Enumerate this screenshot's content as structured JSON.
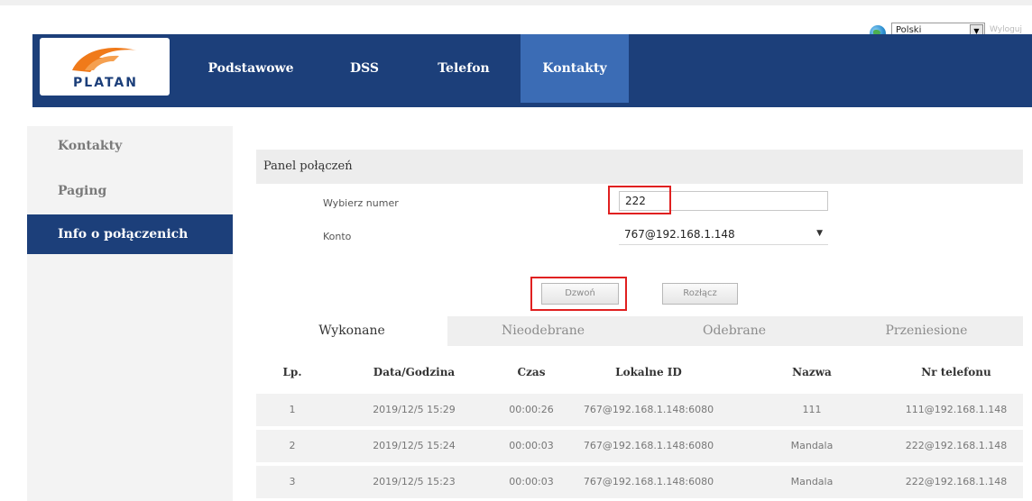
{
  "language": {
    "selected": "Polski",
    "extra": "Wyloguj"
  },
  "header": {
    "logo_text": "PLATAN",
    "nav": [
      {
        "label": "Podstawowe",
        "active": false
      },
      {
        "label": "DSS",
        "active": false
      },
      {
        "label": "Telefon",
        "active": false
      },
      {
        "label": "Kontakty",
        "active": true
      }
    ]
  },
  "sidebar": {
    "items": [
      {
        "label": "Kontakty",
        "active": false
      },
      {
        "label": "Paging",
        "active": false
      },
      {
        "label": "Info o połączenich",
        "active": true
      }
    ]
  },
  "panel": {
    "title": "Panel połączeń",
    "dial_label": "Wybierz numer",
    "dial_value": "222",
    "account_label": "Konto",
    "account_value": "767@192.168.1.148",
    "call_button": "Dzwoń",
    "hangup_button": "Rozłącz"
  },
  "tabs": [
    {
      "label": "Wykonane",
      "active": true
    },
    {
      "label": "Nieodebrane",
      "active": false
    },
    {
      "label": "Odebrane",
      "active": false
    },
    {
      "label": "Przeniesione",
      "active": false
    }
  ],
  "table": {
    "headers": [
      "Lp.",
      "Data/Godzina",
      "Czas",
      "Lokalne ID",
      "Nazwa",
      "Nr telefonu"
    ],
    "rows": [
      [
        "1",
        "2019/12/5 15:29",
        "00:00:26",
        "767@192.168.1.148:6080",
        "111",
        "111@192.168.1.148"
      ],
      [
        "2",
        "2019/12/5 15:24",
        "00:00:03",
        "767@192.168.1.148:6080",
        "Mandala",
        "222@192.168.1.148"
      ],
      [
        "3",
        "2019/12/5 15:23",
        "00:00:03",
        "767@192.168.1.148:6080",
        "Mandala",
        "222@192.168.1.148"
      ]
    ]
  },
  "colors": {
    "nav_bg": "#1c3f7a",
    "nav_active": "#3b6cb5",
    "highlight": "#e02020",
    "logo_orange": "#f07a1a"
  }
}
